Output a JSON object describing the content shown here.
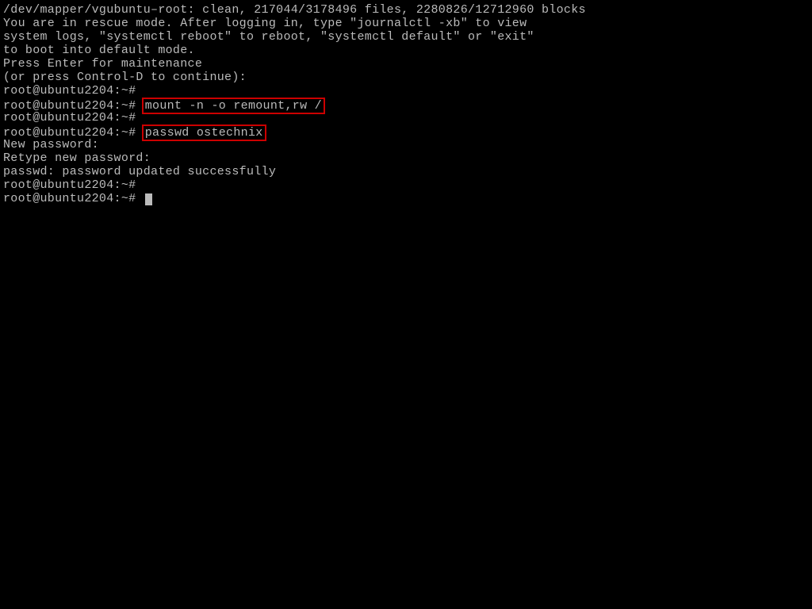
{
  "terminal": {
    "lines": {
      "fsck": "/dev/mapper/vgubuntu–root: clean, 217044/3178496 files, 2280826/12712960 blocks",
      "rescue1": "You are in rescue mode. After logging in, type \"journalctl -xb\" to view",
      "rescue2": "system logs, \"systemctl reboot\" to reboot, \"systemctl default\" or \"exit\"",
      "rescue3": "to boot into default mode.",
      "maintenance": "Press Enter for maintenance",
      "ctrld": "(or press Control-D to continue):",
      "prompt": "root@ubuntu2204:~# ",
      "cmd_mount": "mount -n -o remount,rw /",
      "cmd_passwd": "passwd ostechnix",
      "newpass": "New password:",
      "retype": "Retype new password:",
      "success": "passwd: password updated successfully"
    }
  }
}
